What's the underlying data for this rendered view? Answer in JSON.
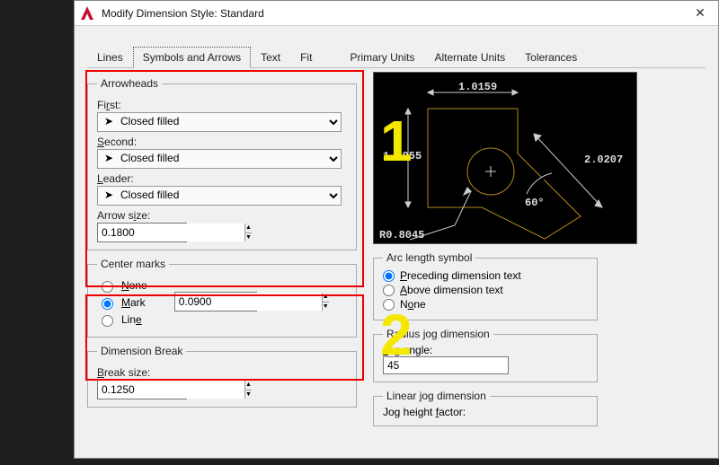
{
  "window": {
    "title": "Modify Dimension Style: Standard",
    "close": "✕",
    "logo_letter": "A"
  },
  "tabs": {
    "lines": "Lines",
    "symbols": "Symbols and Arrows",
    "text": "Text",
    "fit": "Fit",
    "primary": "Primary Units",
    "alternate": "Alternate Units",
    "tolerances": "Tolerances"
  },
  "arrowheads": {
    "legend": "Arrowheads",
    "first_label_pre": "Fi",
    "first_label_u": "r",
    "first_label_post": "st:",
    "first_value": "Closed filled",
    "second_label_u": "S",
    "second_label_post": "econd:",
    "second_value": "Closed filled",
    "leader_label_u": "L",
    "leader_label_post": "eader:",
    "leader_value": "Closed filled",
    "size_pre": "Arrow s",
    "size_u": "i",
    "size_post": "ze:",
    "size_value": "0.1800",
    "arrow_glyph": "➤"
  },
  "centermarks": {
    "legend": "Center marks",
    "none_u": "N",
    "none_post": "one",
    "mark_u": "M",
    "mark_post": "ark",
    "line_pre": "Lin",
    "line_u": "e",
    "value": "0.0900",
    "selected": "mark"
  },
  "dimbreak": {
    "legend": "Dimension Break",
    "break_u": "B",
    "break_post": "reak size:",
    "value": "0.1250"
  },
  "preview": {
    "dim_top": "1.0159",
    "dim_left": "1.1955",
    "dim_right": "2.0207",
    "dim_angle": "60°",
    "dim_radius": "R0.8045"
  },
  "arclength": {
    "legend": "Arc length symbol",
    "preceding_u": "P",
    "preceding_post": "receding dimension text",
    "above_u": "A",
    "above_post": "bove dimension text",
    "none_pre": "N",
    "none_u": "o",
    "none_post": "ne",
    "selected": "preceding"
  },
  "radiusjog": {
    "legend": "Radius jog dimension",
    "label_u": "J",
    "label_post": "og angle:",
    "value": "45"
  },
  "linearjog": {
    "legend": "Linear jog dimension",
    "label_pre": "Jog height ",
    "label_u": "f",
    "label_post": "actor:"
  }
}
